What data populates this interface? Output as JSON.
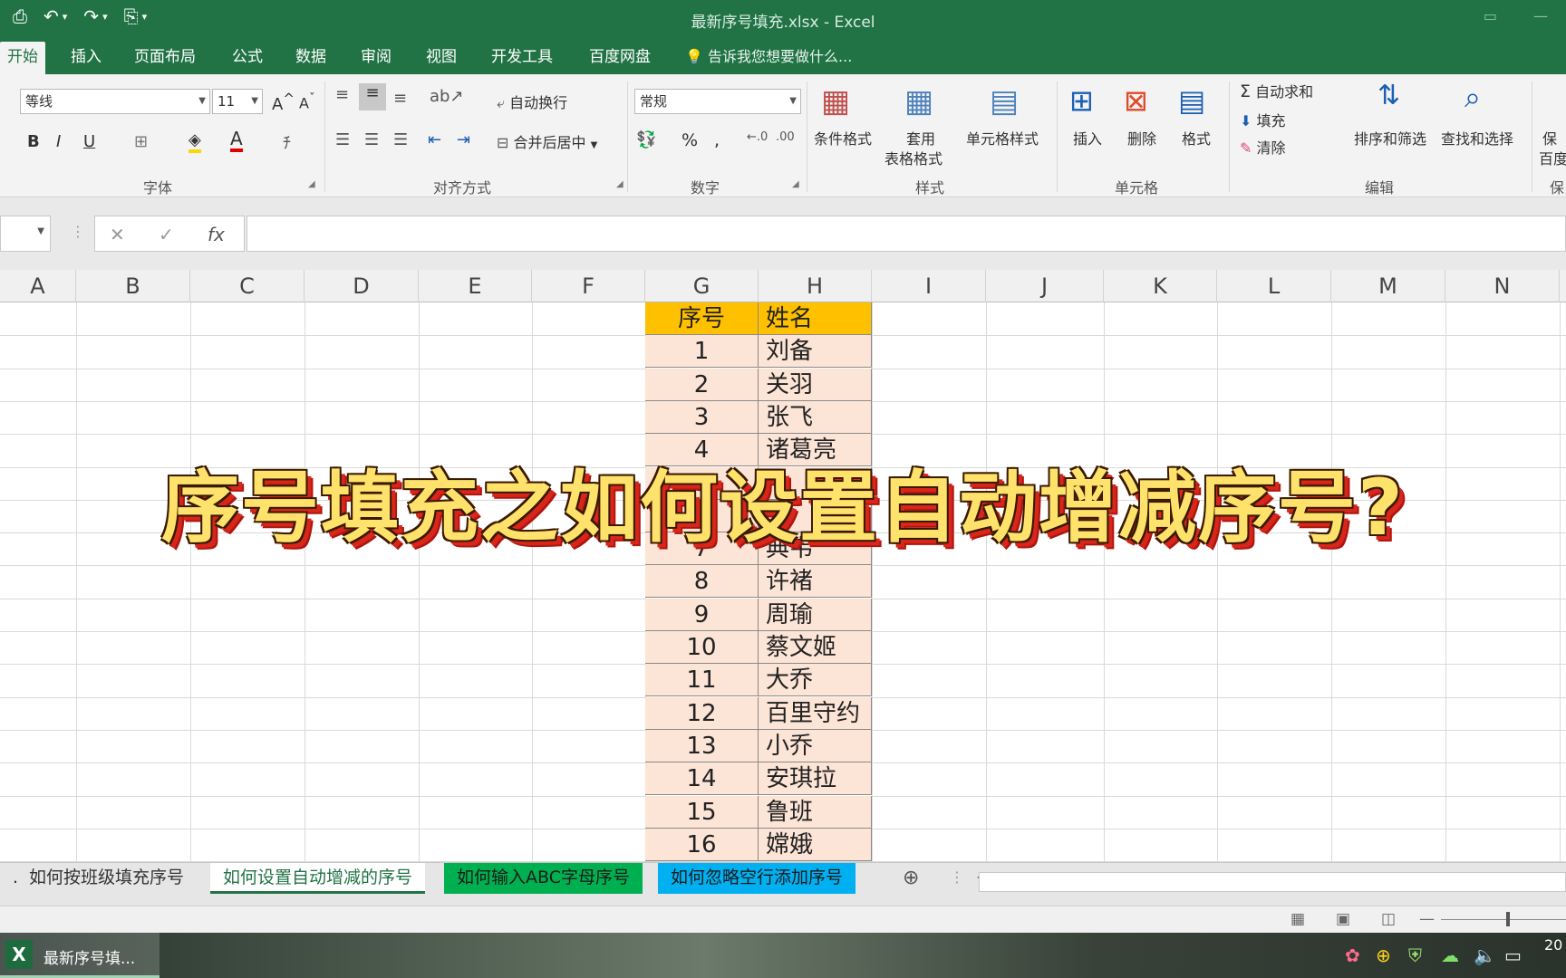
{
  "window": {
    "title": "最新序号填充.xlsx - Excel"
  },
  "ribbon_tabs": [
    "开始",
    "插入",
    "页面布局",
    "公式",
    "数据",
    "审阅",
    "视图",
    "开发工具",
    "百度网盘"
  ],
  "tell_me": "告诉我您想要做什么...",
  "font": {
    "name": "等线",
    "size": "11",
    "group_label": "字体"
  },
  "alignment": {
    "wrap_text": "自动换行",
    "merge_center": "合并后居中",
    "group_label": "对齐方式"
  },
  "number": {
    "format": "常规",
    "group_label": "数字"
  },
  "styles": {
    "conditional": "条件格式",
    "table_format_1": "套用",
    "table_format_2": "表格格式",
    "cell_styles": "单元格样式",
    "group_label": "样式"
  },
  "cells": {
    "insert": "插入",
    "delete": "删除",
    "format": "格式",
    "group_label": "单元格"
  },
  "editing": {
    "autosum": "自动求和",
    "fill": "填充",
    "clear": "清除",
    "sort_filter": "排序和筛选",
    "find_select": "查找和选择",
    "group_label": "编辑"
  },
  "clipped_right": {
    "save_1": "保",
    "save_2": "百度",
    "label": "保"
  },
  "columns": [
    "A",
    "B",
    "C",
    "D",
    "E",
    "F",
    "G",
    "H",
    "I",
    "J",
    "K",
    "L",
    "M",
    "N"
  ],
  "table": {
    "headers": [
      "序号",
      "姓名"
    ],
    "rows": [
      [
        "1",
        "刘备"
      ],
      [
        "2",
        "关羽"
      ],
      [
        "3",
        "张飞"
      ],
      [
        "4",
        "诸葛亮"
      ],
      [
        "5",
        ""
      ],
      [
        "6",
        ""
      ],
      [
        "7",
        "典韦"
      ],
      [
        "8",
        "许褚"
      ],
      [
        "9",
        "周瑜"
      ],
      [
        "10",
        "蔡文姬"
      ],
      [
        "11",
        "大乔"
      ],
      [
        "12",
        "百里守约"
      ],
      [
        "13",
        "小乔"
      ],
      [
        "14",
        "安琪拉"
      ],
      [
        "15",
        "鲁班"
      ],
      [
        "16",
        "嫦娥"
      ]
    ]
  },
  "caption": "序号填充之如何设置自动增减序号?",
  "sheet_tabs": [
    {
      "label": "...",
      "color": "#e6e6e6",
      "text_color": "#333"
    },
    {
      "label": "如何按班级填充序号",
      "color": "#e6e6e6",
      "text_color": "#333"
    },
    {
      "label": "如何设置自动增减的序号",
      "color": "#ffffff",
      "text_color": "#217346"
    },
    {
      "label": "如何输入ABC字母序号",
      "color": "#00b050",
      "text_color": "#1a1a1a"
    },
    {
      "label": "如何忽略空行添加序号",
      "color": "#00b0f0",
      "text_color": "#1a1a1a"
    }
  ],
  "taskbar": {
    "app_label": "最新序号填...",
    "clock": "20"
  },
  "colors": {
    "ribbon_green": "#217346",
    "header_fill": "#ffc000",
    "body_fill": "#fce4d6"
  }
}
